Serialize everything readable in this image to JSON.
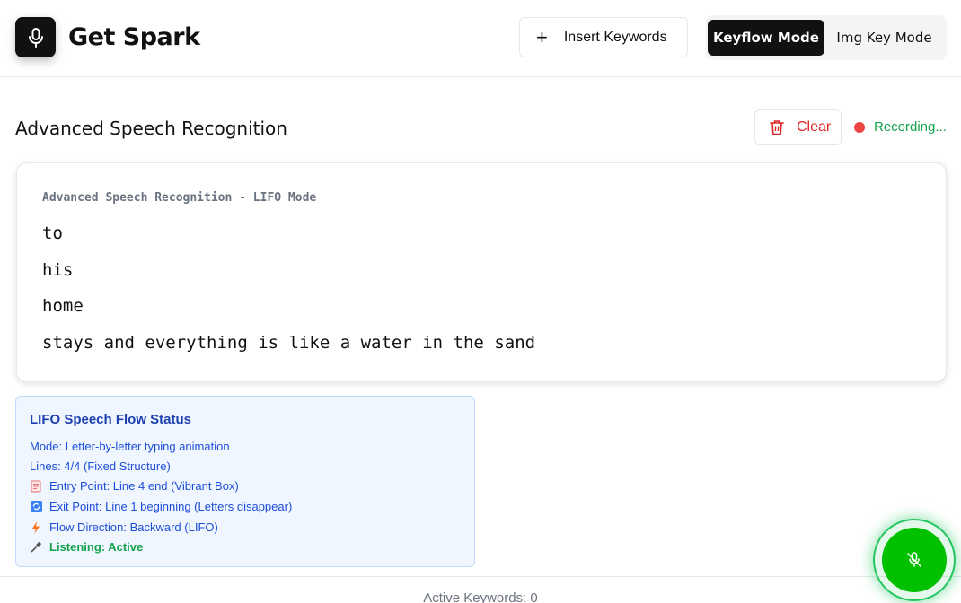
{
  "app": {
    "title": "Get Spark",
    "logo_icon": "microphone-icon"
  },
  "toolbar": {
    "insert_keywords_label": "Insert Keywords",
    "modes": [
      {
        "label": "Keyflow Mode",
        "active": true
      },
      {
        "label": "Img Key Mode",
        "active": false
      }
    ]
  },
  "section": {
    "title": "Advanced Speech Recognition",
    "clear_label": "Clear",
    "recording_label": "Recording..."
  },
  "transcript": {
    "header": "Advanced Speech Recognition - LIFO Mode",
    "lines": [
      "to",
      "his",
      "home",
      "stays and everything is like a water in the sand"
    ]
  },
  "status": {
    "title": "LIFO Speech Flow Status",
    "mode": "Mode: Letter-by-letter typing animation",
    "lines": "Lines: 4/4 (Fixed Structure)",
    "entry": "Entry Point: Line 4 end (Vibrant Box)",
    "exit": "Exit Point: Line 1 beginning (Letters disappear)",
    "flow": "Flow Direction: Backward (LIFO)",
    "listening": "Listening: Active"
  },
  "footer": {
    "active_keywords": "Active Keywords: 0"
  },
  "colors": {
    "accent_dark": "#111111",
    "recording_dot": "#ef4444",
    "recording_text": "#16a34a",
    "clear_red": "#dc2626",
    "status_blue": "#1d4ed8",
    "fab_green": "#00c000"
  }
}
